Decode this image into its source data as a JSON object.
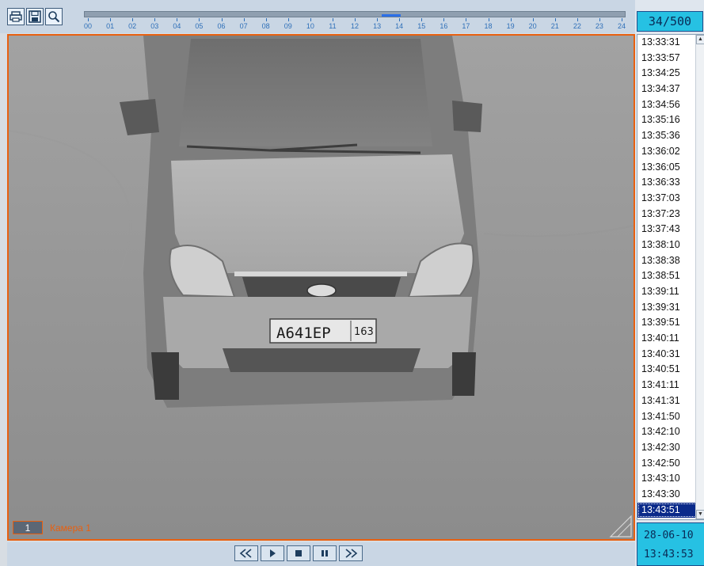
{
  "toolbar": {
    "buttons": [
      "print-icon",
      "save-icon",
      "zoom-icon"
    ],
    "timeline": {
      "hours": [
        "00",
        "01",
        "02",
        "03",
        "04",
        "05",
        "06",
        "07",
        "08",
        "09",
        "10",
        "11",
        "12",
        "13",
        "14",
        "15",
        "16",
        "17",
        "18",
        "19",
        "20",
        "21",
        "22",
        "23",
        "24"
      ],
      "marker_hour": 13.6,
      "marker_color": "#2b6fe8"
    }
  },
  "video": {
    "camera_number": "1",
    "camera_name": "Камера 1",
    "plate_text": "A641EP",
    "plate_region": "163",
    "frame_color": "#e86010"
  },
  "playback": {
    "buttons": [
      "rewind-icon",
      "play-icon",
      "stop-icon",
      "pause-icon",
      "fast-forward-icon"
    ]
  },
  "panel": {
    "counter": "34/500",
    "events": [
      "13:33:31",
      "13:33:57",
      "13:34:25",
      "13:34:37",
      "13:34:56",
      "13:35:16",
      "13:35:36",
      "13:36:02",
      "13:36:05",
      "13:36:33",
      "13:37:03",
      "13:37:23",
      "13:37:43",
      "13:38:10",
      "13:38:38",
      "13:38:51",
      "13:39:11",
      "13:39:31",
      "13:39:51",
      "13:40:11",
      "13:40:31",
      "13:40:51",
      "13:41:11",
      "13:41:31",
      "13:41:50",
      "13:42:10",
      "13:42:30",
      "13:42:50",
      "13:43:10",
      "13:43:30",
      "13:43:51"
    ],
    "selected_index": 30,
    "date": "28-06-10",
    "time": "13:43:53",
    "accent_color": "#26c1e3"
  }
}
